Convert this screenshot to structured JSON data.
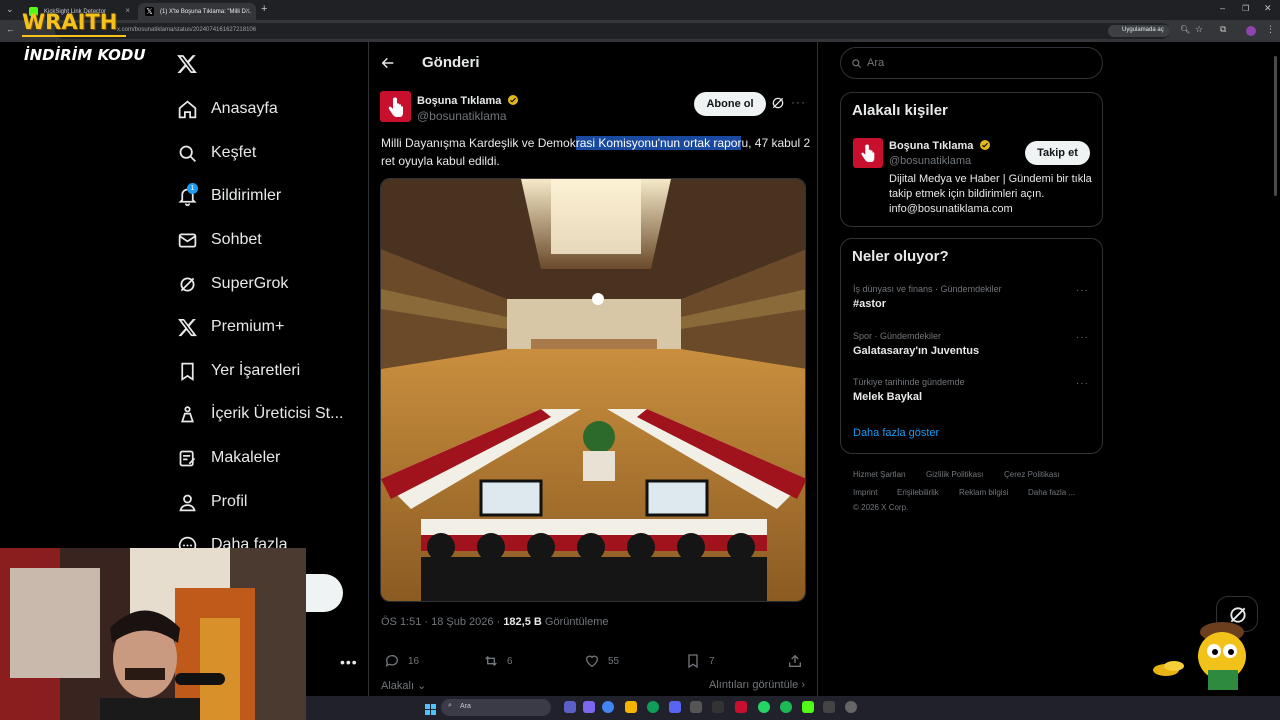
{
  "browser": {
    "tabs": [
      {
        "title": "KickSight Link Detector"
      },
      {
        "title": "(1) X'te Boşuna Tıklama: \"Milli D..."
      }
    ],
    "url": "x.com/bosunatiklama/status/2024074161627218106",
    "open_in_app_label": "Uygulamada aç"
  },
  "overlay": {
    "brand": "WRAITH",
    "discount_label": "İNDİRİM KODU"
  },
  "nav": {
    "items": [
      {
        "label": "Anasayfa",
        "icon": "home-icon"
      },
      {
        "label": "Keşfet",
        "icon": "search-icon"
      },
      {
        "label": "Bildirimler",
        "icon": "bell-icon"
      },
      {
        "label": "Sohbet",
        "icon": "mail-icon"
      },
      {
        "label": "SuperGrok",
        "icon": "grok-icon"
      },
      {
        "label": "Premium+",
        "icon": "x-logo-icon"
      },
      {
        "label": "Yer İşaretleri",
        "icon": "bookmark-icon"
      },
      {
        "label": "İçerik Üreticisi St...",
        "icon": "creator-studio-icon"
      },
      {
        "label": "Makaleler",
        "icon": "article-icon"
      },
      {
        "label": "Profil",
        "icon": "profile-icon"
      },
      {
        "label": "Daha fazla",
        "icon": "more-circle-icon"
      }
    ],
    "notification_count": "1"
  },
  "post": {
    "header_title": "Gönderi",
    "author_name": "Boşuna Tıklama",
    "author_handle": "@bosunatiklama",
    "subscribe_label": "Abone ol",
    "text_before": "Milli Dayanışma Kardeşlik ve Demok",
    "text_highlight": "rasi Komisyonu'nun ortak rapor",
    "text_after": "u, 47 kabul 2 ret oyuyla kabul edildi.",
    "time": "ÖS 1:51 · 18 Şub 2026 ·",
    "views": "182,5 B",
    "views_label": "Görüntüleme",
    "replies": "16",
    "reposts": "6",
    "likes": "55",
    "bookmarks": "7",
    "relevant_label": "Alakalı",
    "view_quotes_label": "Alıntıları görüntüle"
  },
  "sidebar": {
    "search_placeholder": "Ara",
    "related_title": "Alakalı kişiler",
    "related_name": "Boşuna Tıklama",
    "related_handle": "@bosunatiklama",
    "follow_label": "Takip et",
    "related_bio": "Dijital Medya ve Haber | Gündemi bir tıkla takip etmek için bildirimleri açın. info@bosunatiklama.com",
    "trends_title": "Neler oluyor?",
    "trends": [
      {
        "context": "İş dünyası ve finans · Gündemdekiler",
        "name": "#astor"
      },
      {
        "context": "Spor · Gündemdekiler",
        "name": "Galatasaray'ın Juventus"
      },
      {
        "context": "Türkiye tarihinde gündemde",
        "name": "Melek Baykal"
      }
    ],
    "show_more": "Daha fazla göster",
    "footer": {
      "terms": "Hizmet Şartları",
      "privacy": "Gizlilik Politikası",
      "cookies": "Çerez Politikası",
      "imprint": "Imprint",
      "accessibility": "Erişilebilirlik",
      "ads": "Reklam bilgisi",
      "more": "Daha fazla ...",
      "copyright": "© 2026 X Corp."
    }
  },
  "taskbar": {
    "search_placeholder": "Ara"
  },
  "colors": {
    "accent": "#1d9bf0",
    "highlight": "#1a4a9f",
    "brand_red": "#c8102e",
    "overlay_yellow": "#f4c21a"
  }
}
